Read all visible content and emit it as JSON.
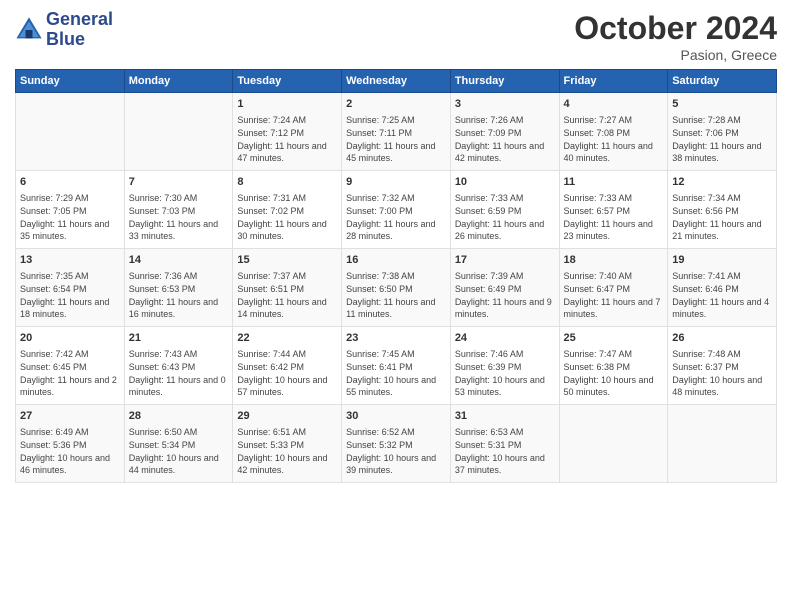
{
  "header": {
    "logo_line1": "General",
    "logo_line2": "Blue",
    "month": "October 2024",
    "location": "Pasion, Greece"
  },
  "days_of_week": [
    "Sunday",
    "Monday",
    "Tuesday",
    "Wednesday",
    "Thursday",
    "Friday",
    "Saturday"
  ],
  "weeks": [
    [
      {
        "day": "",
        "info": ""
      },
      {
        "day": "",
        "info": ""
      },
      {
        "day": "1",
        "info": "Sunrise: 7:24 AM\nSunset: 7:12 PM\nDaylight: 11 hours and 47 minutes."
      },
      {
        "day": "2",
        "info": "Sunrise: 7:25 AM\nSunset: 7:11 PM\nDaylight: 11 hours and 45 minutes."
      },
      {
        "day": "3",
        "info": "Sunrise: 7:26 AM\nSunset: 7:09 PM\nDaylight: 11 hours and 42 minutes."
      },
      {
        "day": "4",
        "info": "Sunrise: 7:27 AM\nSunset: 7:08 PM\nDaylight: 11 hours and 40 minutes."
      },
      {
        "day": "5",
        "info": "Sunrise: 7:28 AM\nSunset: 7:06 PM\nDaylight: 11 hours and 38 minutes."
      }
    ],
    [
      {
        "day": "6",
        "info": "Sunrise: 7:29 AM\nSunset: 7:05 PM\nDaylight: 11 hours and 35 minutes."
      },
      {
        "day": "7",
        "info": "Sunrise: 7:30 AM\nSunset: 7:03 PM\nDaylight: 11 hours and 33 minutes."
      },
      {
        "day": "8",
        "info": "Sunrise: 7:31 AM\nSunset: 7:02 PM\nDaylight: 11 hours and 30 minutes."
      },
      {
        "day": "9",
        "info": "Sunrise: 7:32 AM\nSunset: 7:00 PM\nDaylight: 11 hours and 28 minutes."
      },
      {
        "day": "10",
        "info": "Sunrise: 7:33 AM\nSunset: 6:59 PM\nDaylight: 11 hours and 26 minutes."
      },
      {
        "day": "11",
        "info": "Sunrise: 7:33 AM\nSunset: 6:57 PM\nDaylight: 11 hours and 23 minutes."
      },
      {
        "day": "12",
        "info": "Sunrise: 7:34 AM\nSunset: 6:56 PM\nDaylight: 11 hours and 21 minutes."
      }
    ],
    [
      {
        "day": "13",
        "info": "Sunrise: 7:35 AM\nSunset: 6:54 PM\nDaylight: 11 hours and 18 minutes."
      },
      {
        "day": "14",
        "info": "Sunrise: 7:36 AM\nSunset: 6:53 PM\nDaylight: 11 hours and 16 minutes."
      },
      {
        "day": "15",
        "info": "Sunrise: 7:37 AM\nSunset: 6:51 PM\nDaylight: 11 hours and 14 minutes."
      },
      {
        "day": "16",
        "info": "Sunrise: 7:38 AM\nSunset: 6:50 PM\nDaylight: 11 hours and 11 minutes."
      },
      {
        "day": "17",
        "info": "Sunrise: 7:39 AM\nSunset: 6:49 PM\nDaylight: 11 hours and 9 minutes."
      },
      {
        "day": "18",
        "info": "Sunrise: 7:40 AM\nSunset: 6:47 PM\nDaylight: 11 hours and 7 minutes."
      },
      {
        "day": "19",
        "info": "Sunrise: 7:41 AM\nSunset: 6:46 PM\nDaylight: 11 hours and 4 minutes."
      }
    ],
    [
      {
        "day": "20",
        "info": "Sunrise: 7:42 AM\nSunset: 6:45 PM\nDaylight: 11 hours and 2 minutes."
      },
      {
        "day": "21",
        "info": "Sunrise: 7:43 AM\nSunset: 6:43 PM\nDaylight: 11 hours and 0 minutes."
      },
      {
        "day": "22",
        "info": "Sunrise: 7:44 AM\nSunset: 6:42 PM\nDaylight: 10 hours and 57 minutes."
      },
      {
        "day": "23",
        "info": "Sunrise: 7:45 AM\nSunset: 6:41 PM\nDaylight: 10 hours and 55 minutes."
      },
      {
        "day": "24",
        "info": "Sunrise: 7:46 AM\nSunset: 6:39 PM\nDaylight: 10 hours and 53 minutes."
      },
      {
        "day": "25",
        "info": "Sunrise: 7:47 AM\nSunset: 6:38 PM\nDaylight: 10 hours and 50 minutes."
      },
      {
        "day": "26",
        "info": "Sunrise: 7:48 AM\nSunset: 6:37 PM\nDaylight: 10 hours and 48 minutes."
      }
    ],
    [
      {
        "day": "27",
        "info": "Sunrise: 6:49 AM\nSunset: 5:36 PM\nDaylight: 10 hours and 46 minutes."
      },
      {
        "day": "28",
        "info": "Sunrise: 6:50 AM\nSunset: 5:34 PM\nDaylight: 10 hours and 44 minutes."
      },
      {
        "day": "29",
        "info": "Sunrise: 6:51 AM\nSunset: 5:33 PM\nDaylight: 10 hours and 42 minutes."
      },
      {
        "day": "30",
        "info": "Sunrise: 6:52 AM\nSunset: 5:32 PM\nDaylight: 10 hours and 39 minutes."
      },
      {
        "day": "31",
        "info": "Sunrise: 6:53 AM\nSunset: 5:31 PM\nDaylight: 10 hours and 37 minutes."
      },
      {
        "day": "",
        "info": ""
      },
      {
        "day": "",
        "info": ""
      }
    ]
  ]
}
